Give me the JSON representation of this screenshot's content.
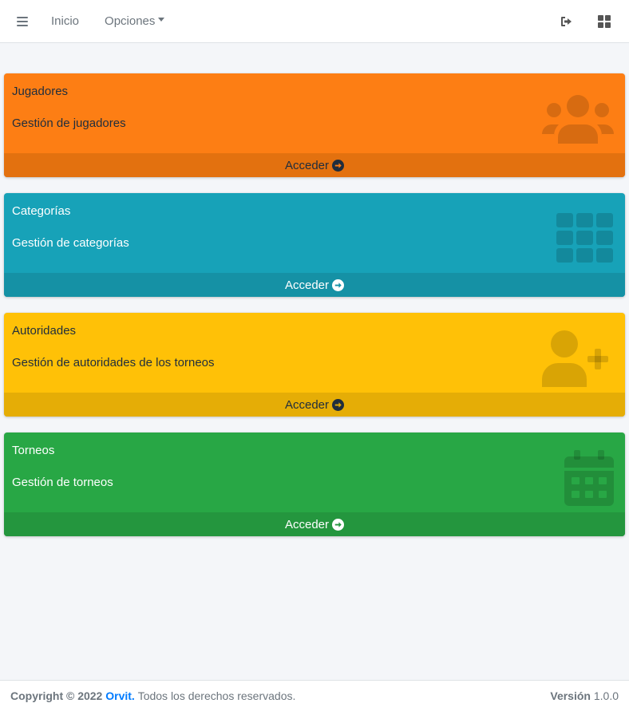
{
  "navbar": {
    "menu_icon": "bars-icon",
    "home_label": "Inicio",
    "options_label": "Opciones",
    "logout_icon": "sign-out-icon",
    "apps_icon": "grid-icon"
  },
  "cards": [
    {
      "title": "Jugadores",
      "description": "Gestión de jugadores",
      "action_label": "Acceder",
      "icon": "users-icon",
      "color": "#fd7e14"
    },
    {
      "title": "Categorías",
      "description": "Gestión de categorías",
      "action_label": "Acceder",
      "icon": "th-grid-icon",
      "color": "#17a2b8"
    },
    {
      "title": "Autoridades",
      "description": "Gestión de autoridades de los torneos",
      "action_label": "Acceder",
      "icon": "user-plus-icon",
      "color": "#ffc107"
    },
    {
      "title": "Torneos",
      "description": "Gestión de torneos",
      "action_label": "Acceder",
      "icon": "calendar-icon",
      "color": "#28a745"
    }
  ],
  "footer": {
    "copyright": "Copyright © 2022",
    "brand": "Orvit.",
    "rights": "Todos los derechos reservados.",
    "version_label": "Versión",
    "version_value": "1.0.0"
  }
}
